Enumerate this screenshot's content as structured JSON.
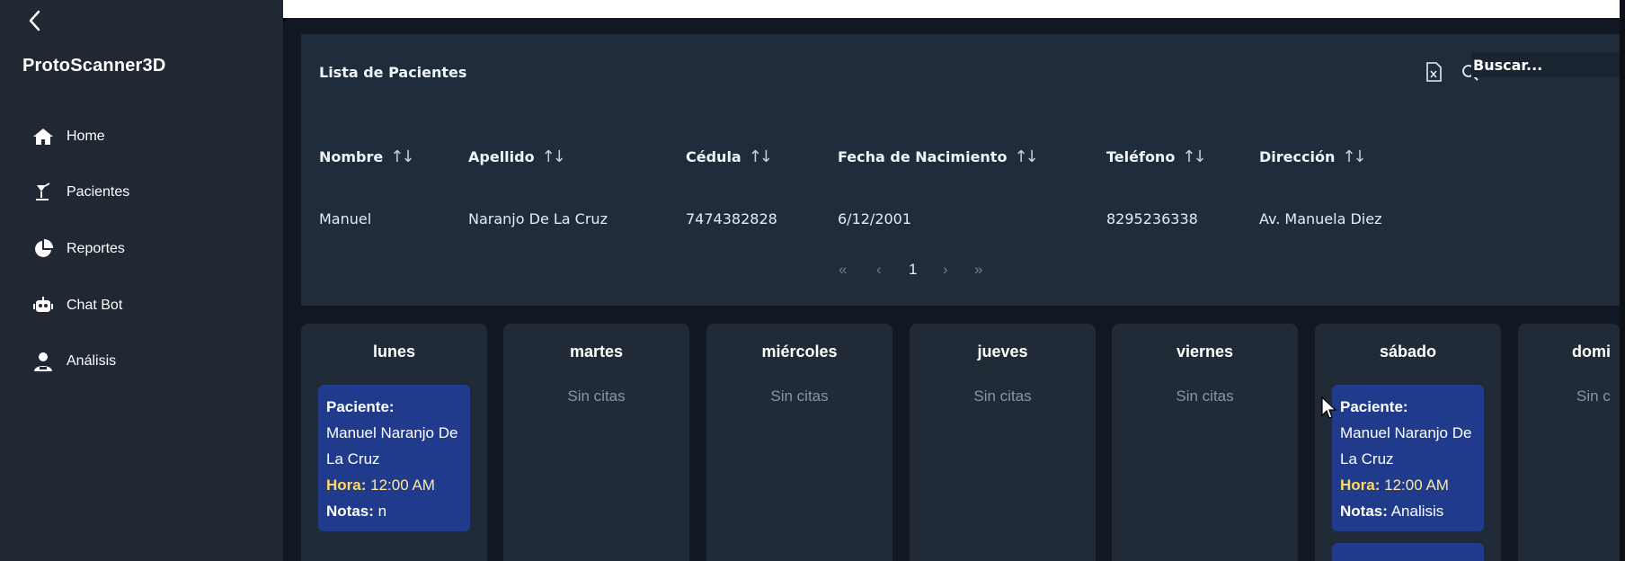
{
  "app": {
    "title": "ProtoScanner3D",
    "back_icon": "chevron-left-icon"
  },
  "sidebar": {
    "items": [
      {
        "label": "Home",
        "icon": "home-icon"
      },
      {
        "label": "Pacientes",
        "icon": "patient-icon"
      },
      {
        "label": "Reportes",
        "icon": "pie-chart-icon"
      },
      {
        "label": "Chat Bot",
        "icon": "robot-icon"
      },
      {
        "label": "Análisis",
        "icon": "user-doctor-icon"
      }
    ]
  },
  "patients": {
    "title": "Lista de Pacientes",
    "export_icon": "excel-file-icon",
    "search_icon": "search-icon",
    "search_placeholder": "Buscar...",
    "columns": [
      "Nombre",
      "Apellido",
      "Cédula",
      "Fecha de Nacimiento",
      "Teléfono",
      "Dirección"
    ],
    "sort_glyph": "↑↓",
    "rows": [
      [
        "Manuel",
        "Naranjo De La Cruz",
        "7474382828",
        "6/12/2001",
        "8295236338",
        "Av. Manuela Diez"
      ]
    ],
    "pagination": {
      "first": "«",
      "prev": "‹",
      "current_page": "1",
      "next": "›",
      "last": "»"
    }
  },
  "calendar": {
    "empty_text": "Sin citas",
    "days": [
      {
        "name": "lunes",
        "appointment": {
          "patient_label": "Paciente:",
          "patient_name": "Manuel Naranjo De La Cruz",
          "time_label": "Hora:",
          "time": "12:00 AM",
          "notes_label": "Notas:",
          "notes": "n"
        }
      },
      {
        "name": "martes"
      },
      {
        "name": "miércoles"
      },
      {
        "name": "jueves"
      },
      {
        "name": "viernes"
      },
      {
        "name": "sábado",
        "appointment": {
          "patient_label": "Paciente:",
          "patient_name": "Manuel Naranjo De La Cruz",
          "time_label": "Hora:",
          "time": "12:00 AM",
          "notes_label": "Notas:",
          "notes": "Analisis"
        }
      },
      {
        "name": "domi",
        "empty_text": "Sin c"
      }
    ]
  },
  "colors": {
    "sidebar_bg": "#1f2833",
    "main_bg": "#111823",
    "panel_bg": "#202c3b",
    "day_card_bg": "#212b37",
    "appointment_bg": "#213b8c",
    "hora_accent": "#ffd860"
  }
}
